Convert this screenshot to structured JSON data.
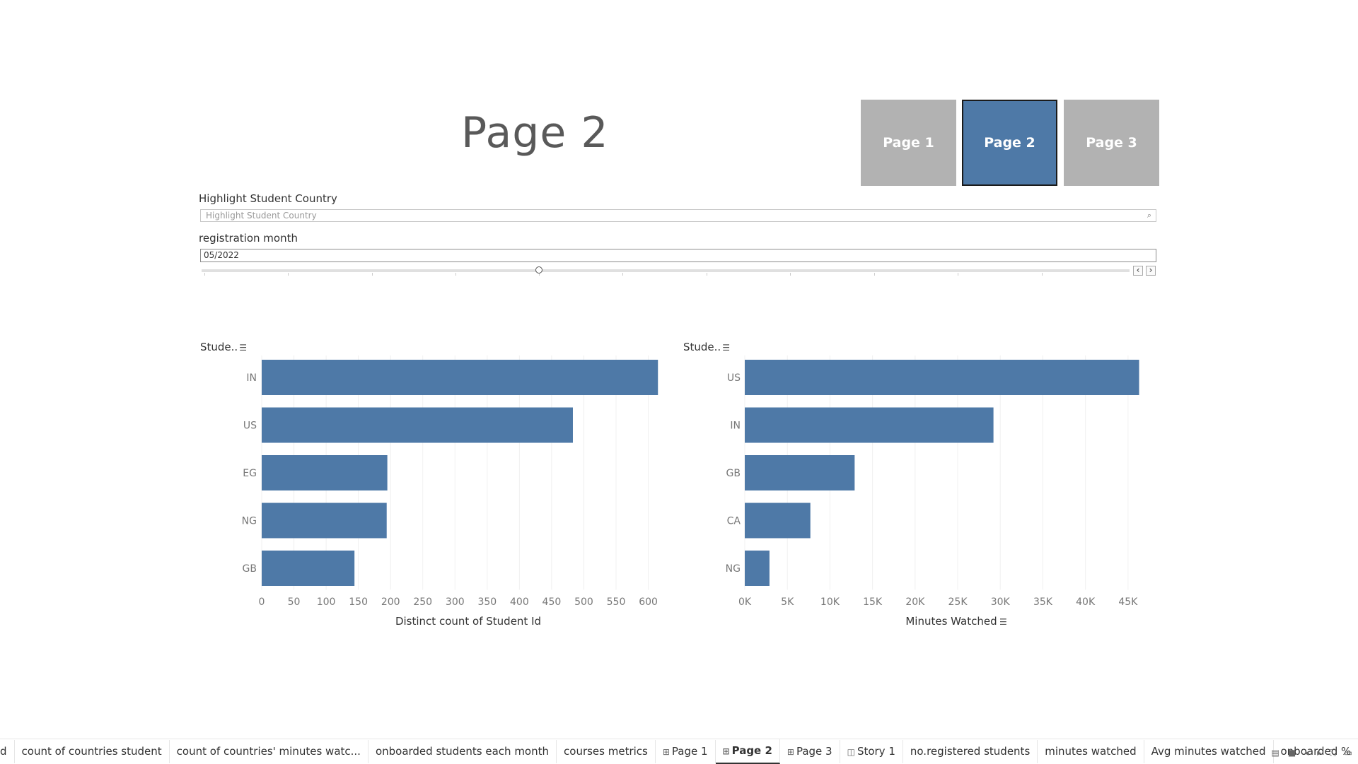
{
  "header": {
    "title": "Page 2",
    "nav_buttons": [
      "Page 1",
      "Page 2",
      "Page 3"
    ],
    "active_button": "Page 2"
  },
  "filters": {
    "highlight_label": "Highlight Student Country",
    "highlight_placeholder": "Highlight Student Country",
    "month_label": "registration month",
    "month_value": "05/2022"
  },
  "charts": {
    "left_header": "Stude..",
    "right_header": "Stude.."
  },
  "chart_data": [
    {
      "type": "bar",
      "orientation": "horizontal",
      "categories": [
        "IN",
        "US",
        "EG",
        "NG",
        "GB"
      ],
      "values": [
        615,
        483,
        195,
        194,
        144
      ],
      "xlabel": "Distinct count of Student Id",
      "ylabel": "Stude..",
      "xlim": [
        0,
        640
      ],
      "ticks": [
        "0",
        "50",
        "100",
        "150",
        "200",
        "250",
        "300",
        "350",
        "400",
        "450",
        "500",
        "550",
        "600"
      ],
      "color": "#4e79a7",
      "grid": true
    },
    {
      "type": "bar",
      "orientation": "horizontal",
      "categories": [
        "US",
        "IN",
        "GB",
        "CA",
        "NG"
      ],
      "values": [
        46300,
        29200,
        12900,
        7700,
        2900
      ],
      "xlabel": "Minutes Watched",
      "ylabel": "Stude..",
      "xlim": [
        0,
        48500
      ],
      "ticks": [
        "0K",
        "5K",
        "10K",
        "15K",
        "20K",
        "25K",
        "30K",
        "35K",
        "40K",
        "45K"
      ],
      "color": "#4e79a7",
      "grid": true
    }
  ],
  "tabs": [
    {
      "label": "d",
      "icon": ""
    },
    {
      "label": "count of countries student",
      "icon": ""
    },
    {
      "label": "count of countries' minutes watc...",
      "icon": ""
    },
    {
      "label": "onboarded students each month",
      "icon": ""
    },
    {
      "label": "courses metrics",
      "icon": ""
    },
    {
      "label": "Page 1",
      "icon": "⊞"
    },
    {
      "label": "Page 2",
      "icon": "⊞"
    },
    {
      "label": "Page 3",
      "icon": "⊞"
    },
    {
      "label": "Story 1",
      "icon": "◫"
    },
    {
      "label": "no.registered students",
      "icon": ""
    },
    {
      "label": "minutes watched",
      "icon": ""
    },
    {
      "label": "Avg minutes watched",
      "icon": ""
    },
    {
      "label": "onboarded %",
      "icon": ""
    }
  ],
  "active_tab": "Page 2"
}
